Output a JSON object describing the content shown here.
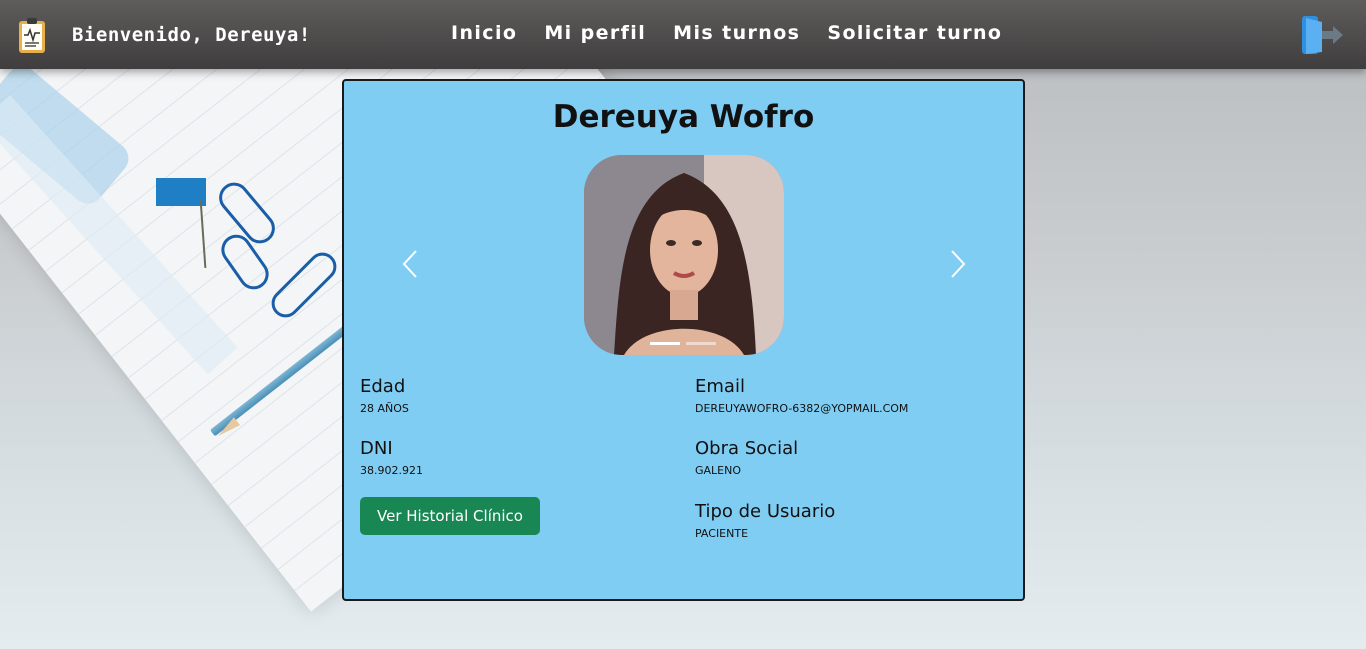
{
  "header": {
    "welcome": "Bienvenido, Dereuya!",
    "nav": [
      "Inicio",
      "Mi perfil",
      "Mis turnos",
      "Solicitar turno"
    ]
  },
  "profile": {
    "name": "Dereuya Wofro",
    "fields": {
      "edad": {
        "label": "Edad",
        "value": "28 AÑOS"
      },
      "email": {
        "label": "Email",
        "value": "DEREUYAWOFRO-6382@YOPMAIL.COM"
      },
      "dni": {
        "label": "DNI",
        "value": "38.902.921"
      },
      "obra_social": {
        "label": "Obra Social",
        "value": "GALENO"
      },
      "tipo_usuario": {
        "label": "Tipo de Usuario",
        "value": "PACIENTE"
      }
    },
    "historial_button": "Ver Historial Clínico"
  },
  "carousel": {
    "slides": 2,
    "active": 0
  },
  "colors": {
    "card_bg": "#80cdf4",
    "header_bg": "#4a4848",
    "button_green": "#198754",
    "logout_icon": "#3d9de6"
  }
}
